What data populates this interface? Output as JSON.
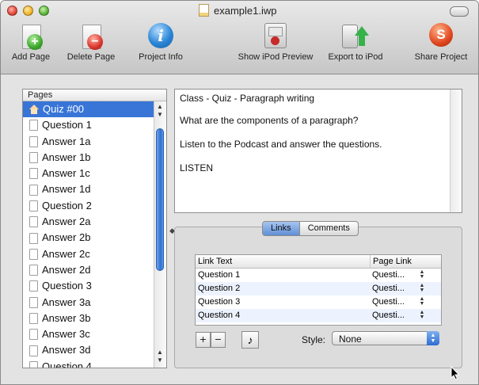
{
  "window": {
    "title": "example1.iwp"
  },
  "toolbar": {
    "items": [
      {
        "id": "add",
        "label": "Add Page",
        "icon": "add-page-icon"
      },
      {
        "id": "delete",
        "label": "Delete Page",
        "icon": "delete-page-icon"
      },
      {
        "id": "info",
        "label": "Project Info",
        "icon": "info-icon"
      },
      {
        "id": "ipod",
        "label": "Show iPod Preview",
        "icon": "ipod-preview-icon"
      },
      {
        "id": "export",
        "label": "Export to iPod",
        "icon": "export-ipod-icon"
      },
      {
        "id": "share",
        "label": "Share Project",
        "icon": "share-project-icon"
      }
    ]
  },
  "pages": {
    "header": "Pages",
    "items": [
      {
        "label": "Quiz #00",
        "icon": "home-icon",
        "selected": true
      },
      {
        "label": "Question 1",
        "icon": "page-icon"
      },
      {
        "label": "Answer 1a",
        "icon": "page-icon"
      },
      {
        "label": "Answer 1b",
        "icon": "page-icon"
      },
      {
        "label": "Answer 1c",
        "icon": "page-icon"
      },
      {
        "label": "Answer 1d",
        "icon": "page-icon"
      },
      {
        "label": "Question 2",
        "icon": "page-icon"
      },
      {
        "label": "Answer 2a",
        "icon": "page-icon"
      },
      {
        "label": "Answer 2b",
        "icon": "page-icon"
      },
      {
        "label": "Answer 2c",
        "icon": "page-icon"
      },
      {
        "label": "Answer 2d",
        "icon": "page-icon"
      },
      {
        "label": "Question 3",
        "icon": "page-icon"
      },
      {
        "label": "Answer 3a",
        "icon": "page-icon"
      },
      {
        "label": "Answer 3b",
        "icon": "page-icon"
      },
      {
        "label": "Answer 3c",
        "icon": "page-icon"
      },
      {
        "label": "Answer 3d",
        "icon": "page-icon"
      },
      {
        "label": "Question 4",
        "icon": "page-icon"
      }
    ]
  },
  "content": {
    "lines": [
      "Class - Quiz - Paragraph writing",
      "What are the components of a paragraph?",
      "Listen to the Podcast and answer the questions.",
      "LISTEN"
    ]
  },
  "tabs": {
    "links_label": "Links",
    "comments_label": "Comments",
    "selected": "Links"
  },
  "links_table": {
    "columns": [
      "Link Text",
      "Page Link"
    ],
    "rows": [
      {
        "text": "Question 1",
        "page": "Questi..."
      },
      {
        "text": "Question 2",
        "page": "Questi..."
      },
      {
        "text": "Question 3",
        "page": "Questi..."
      },
      {
        "text": "Question 4",
        "page": "Questi..."
      }
    ]
  },
  "controls": {
    "add_label": "+",
    "remove_label": "−",
    "sound_icon": "music-note-icon",
    "style_label": "Style:",
    "style_value": "None"
  },
  "colors": {
    "selection": "#3875d7",
    "scroll_thumb": "#2f6fd0",
    "row_alt": "#edf3fe"
  }
}
